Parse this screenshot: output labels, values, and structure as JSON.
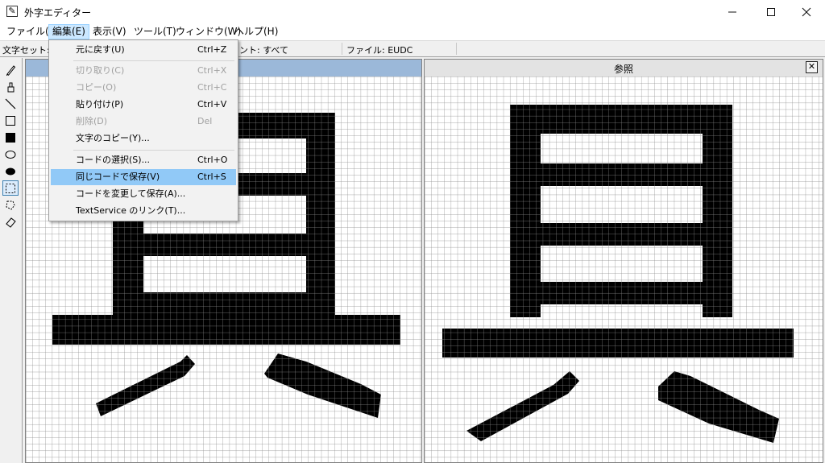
{
  "window": {
    "title": "外字エディター",
    "app_icon": "pencil-icon",
    "controls": [
      "minimize-icon",
      "maximize-icon",
      "close-icon"
    ]
  },
  "menubar": {
    "items": [
      {
        "label": "ファイル(F)"
      },
      {
        "label": "編集(E)",
        "active": true
      },
      {
        "label": "表示(V)"
      },
      {
        "label": "ツール(T)"
      },
      {
        "label": "ウィンドウ(W)"
      },
      {
        "label": "ヘルプ(H)"
      }
    ]
  },
  "status": {
    "charset": "文字セット:",
    "font": "ント: すべて",
    "file": "ファイル: EUDC"
  },
  "toolbar": {
    "tools": [
      "pencil-icon",
      "brush-icon",
      "line-icon",
      "rectangle-outline-icon",
      "rectangle-filled-icon",
      "ellipse-outline-icon",
      "ellipse-filled-icon",
      "rect-select-icon",
      "lasso-select-icon",
      "eraser-icon"
    ],
    "selected": 7
  },
  "reference_pane": {
    "title": "参照",
    "close": "✕"
  },
  "edit_menu": {
    "items": [
      {
        "label": "元に戻す(U)",
        "shortcut": "Ctrl+Z"
      },
      {
        "label": "切り取り(C)",
        "shortcut": "Ctrl+X",
        "disabled": true
      },
      {
        "label": "コピー(O)",
        "shortcut": "Ctrl+C",
        "disabled": true
      },
      {
        "label": "貼り付け(P)",
        "shortcut": "Ctrl+V"
      },
      {
        "label": "削除(D)",
        "shortcut": "Del",
        "disabled": true
      },
      {
        "label": "文字のコピー(Y)...",
        "shortcut": ""
      },
      {
        "label": "コードの選択(S)...",
        "shortcut": "Ctrl+O"
      },
      {
        "label": "同じコードで保存(V)",
        "shortcut": "Ctrl+S",
        "highlighted": true
      },
      {
        "label": "コードを変更して保存(A)...",
        "shortcut": ""
      },
      {
        "label": "TextService のリンク(T)...",
        "shortcut": ""
      }
    ]
  },
  "colors": {
    "accent_header": "#9bb8d9",
    "menu_highlight": "#91c9f7",
    "menubar_active": "#cce8ff",
    "grid_line": "#8a8a8a",
    "ink": "#000000"
  }
}
